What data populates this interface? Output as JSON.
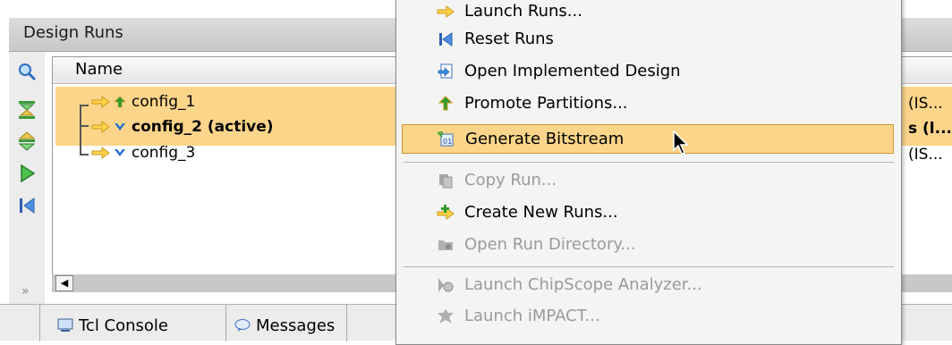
{
  "panel": {
    "title": "Design Runs",
    "column_name": "Name"
  },
  "runs": [
    {
      "label": "config_1",
      "status": "promote",
      "right_text": "(IS..."
    },
    {
      "label": "config_2 (active)",
      "status": "done",
      "right_text": "s (l...",
      "bold": true
    },
    {
      "label": "config_3",
      "status": "done",
      "right_text": "(IS..."
    }
  ],
  "toolbar": {
    "icons": [
      "search-icon",
      "collapse-all-icon",
      "expand-all-icon",
      "launch-run-icon",
      "reset-runs-icon"
    ]
  },
  "tabs": [
    {
      "label": "Tcl Console",
      "icon": "console-icon"
    },
    {
      "label": "Messages",
      "icon": "messages-icon"
    }
  ],
  "menu": {
    "items": [
      {
        "label": "Launch Runs...",
        "icon": "launch-icon",
        "disabled": false
      },
      {
        "label": "Reset Runs",
        "icon": "reset-icon",
        "disabled": false
      },
      {
        "label": "Open Implemented Design",
        "icon": "open-design-icon",
        "disabled": false
      },
      {
        "label": "Promote Partitions...",
        "icon": "promote-icon",
        "disabled": false
      },
      {
        "label": "Generate Bitstream",
        "icon": "bitstream-icon",
        "disabled": false,
        "selected": true
      },
      {
        "label": "Copy Run...",
        "icon": "copy-icon",
        "disabled": true
      },
      {
        "label": "Create New Runs...",
        "icon": "create-runs-icon",
        "disabled": false
      },
      {
        "label": "Open Run Directory...",
        "icon": "folder-icon",
        "disabled": true
      },
      {
        "label": "Launch ChipScope Analyzer...",
        "icon": "chipscope-icon",
        "disabled": true
      },
      {
        "label": "Launch iMPACT...",
        "icon": "impact-icon",
        "disabled": true
      }
    ]
  },
  "colors": {
    "selection": "#fcd58a",
    "selection_border": "#c8962e",
    "disabled_text": "#9a9a9a",
    "check_blue": "#1f6fd6",
    "promote_green": "#2e9c2e"
  }
}
